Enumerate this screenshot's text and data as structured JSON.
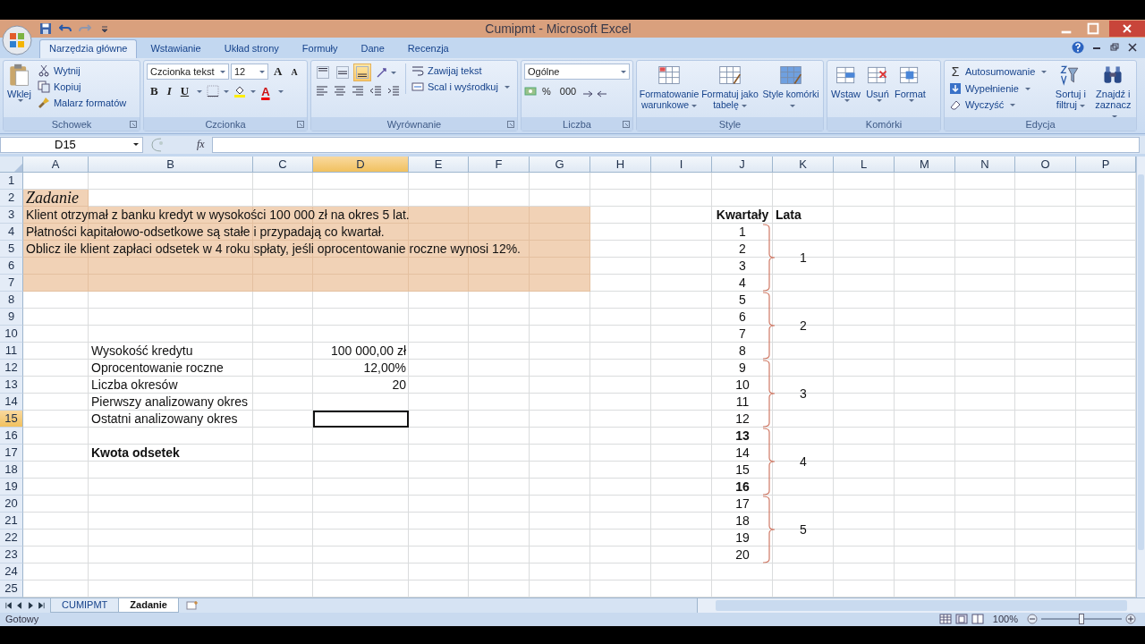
{
  "window": {
    "title": "Cumipmt - Microsoft Excel"
  },
  "tabs": [
    {
      "label": "Narzędzia główne",
      "selected": true
    },
    {
      "label": "Wstawianie",
      "selected": false
    },
    {
      "label": "Układ strony",
      "selected": false
    },
    {
      "label": "Formuły",
      "selected": false
    },
    {
      "label": "Dane",
      "selected": false
    },
    {
      "label": "Recenzja",
      "selected": false
    }
  ],
  "ribbon": {
    "clipboard": {
      "title": "Schowek",
      "paste": "Wklej",
      "cut": "Wytnij",
      "copy": "Kopiuj",
      "painter": "Malarz formatów"
    },
    "font": {
      "title": "Czcionka",
      "font_name": "Czcionka tekst",
      "font_size": "12",
      "grow": "A",
      "shrink": "A",
      "bold": "B",
      "italic": "I",
      "underline": "U",
      "text_color_letter": "A"
    },
    "alignment": {
      "title": "Wyrównanie",
      "vertical": [
        {
          "selected": false
        },
        {
          "selected": false
        },
        {
          "selected": true
        }
      ],
      "wrap": "Zawijaj tekst",
      "merge": "Scal i wyśrodkuj"
    },
    "number": {
      "title": "Liczba",
      "format": "Ogólne",
      "percent": "%",
      "thousands": "000"
    },
    "styles": {
      "title": "Style",
      "items": [
        "Formatowanie warunkowe",
        "Formatuj jako tabelę",
        "Style komórki"
      ]
    },
    "cells": {
      "title": "Komórki",
      "items": [
        "Wstaw",
        "Usuń",
        "Format"
      ]
    },
    "editing": {
      "title": "Edycja",
      "sigma": "Σ",
      "autosum": "Autosumowanie",
      "fill": "Wypełnienie",
      "clear": "Wyczyść",
      "sort": "Sortuj i filtruj",
      "find": "Znajdź i zaznacz"
    }
  },
  "formula_bar": {
    "name_box": "D15",
    "fx": "fx"
  },
  "sheet": {
    "columns": [
      {
        "label": "A",
        "selected": false
      },
      {
        "label": "B",
        "selected": false
      },
      {
        "label": "C",
        "selected": false
      },
      {
        "label": "D",
        "selected": true
      },
      {
        "label": "E",
        "selected": false
      },
      {
        "label": "F",
        "selected": false
      },
      {
        "label": "G",
        "selected": false
      },
      {
        "label": "H",
        "selected": false
      },
      {
        "label": "I",
        "selected": false
      },
      {
        "label": "J",
        "selected": false
      },
      {
        "label": "K",
        "selected": false
      },
      {
        "label": "L",
        "selected": false
      },
      {
        "label": "M",
        "selected": false
      },
      {
        "label": "N",
        "selected": false
      },
      {
        "label": "O",
        "selected": false
      },
      {
        "label": "P",
        "selected": false
      }
    ],
    "rows": [
      {
        "label": "1",
        "selected": false,
        "cells": {}
      },
      {
        "label": "2",
        "selected": false,
        "cells": {
          "A": {
            "text": "Zadanie",
            "italic": true,
            "shaded": true
          }
        }
      },
      {
        "label": "3",
        "selected": false,
        "cells": {
          "A": {
            "text": "Klient otrzymał z banku kredyt w wysokości 100 000 zł na okres 5 lat.",
            "shaded": true
          },
          "B": {
            "shaded": true
          },
          "C": {
            "shaded": true
          },
          "D": {
            "shaded": true
          },
          "E": {
            "shaded": true
          },
          "F": {
            "shaded": true
          },
          "G": {
            "shaded": true
          },
          "J": {
            "text": "Kwartały",
            "bold": true
          },
          "K": {
            "text": "Lata",
            "bold": true
          }
        }
      },
      {
        "label": "4",
        "selected": false,
        "cells": {
          "A": {
            "text": "Płatności kapitałowo-odsetkowe są stałe i przypadają co kwartał.",
            "shaded": true
          },
          "B": {
            "shaded": true
          },
          "C": {
            "shaded": true
          },
          "D": {
            "shaded": true
          },
          "E": {
            "shaded": true
          },
          "F": {
            "shaded": true
          },
          "G": {
            "shaded": true
          },
          "J": {
            "text": "1"
          }
        }
      },
      {
        "label": "5",
        "selected": false,
        "cells": {
          "A": {
            "text": "Oblicz ile klient zapłaci odsetek w 4 roku spłaty, jeśli oprocentowanie roczne wynosi 12%.",
            "shaded": true
          },
          "B": {
            "shaded": true
          },
          "C": {
            "shaded": true
          },
          "D": {
            "shaded": true
          },
          "E": {
            "shaded": true
          },
          "F": {
            "shaded": true
          },
          "G": {
            "shaded": true
          },
          "J": {
            "text": "2"
          }
        }
      },
      {
        "label": "6",
        "selected": false,
        "cells": {
          "A": {
            "shaded": true
          },
          "B": {
            "shaded": true
          },
          "C": {
            "shaded": true
          },
          "D": {
            "shaded": true
          },
          "E": {
            "shaded": true
          },
          "F": {
            "shaded": true
          },
          "G": {
            "shaded": true
          },
          "J": {
            "text": "3"
          }
        }
      },
      {
        "label": "7",
        "selected": false,
        "cells": {
          "A": {
            "shaded": true
          },
          "B": {
            "shaded": true
          },
          "C": {
            "shaded": true
          },
          "D": {
            "shaded": true
          },
          "E": {
            "shaded": true
          },
          "F": {
            "shaded": true
          },
          "G": {
            "shaded": true
          },
          "J": {
            "text": "4"
          }
        }
      },
      {
        "label": "8",
        "selected": false,
        "cells": {
          "J": {
            "text": "5"
          }
        }
      },
      {
        "label": "9",
        "selected": false,
        "cells": {
          "J": {
            "text": "6"
          }
        }
      },
      {
        "label": "10",
        "selected": false,
        "cells": {
          "J": {
            "text": "7"
          }
        }
      },
      {
        "label": "11",
        "selected": false,
        "cells": {
          "B": {
            "text": "Wysokość kredytu"
          },
          "D": {
            "text": "100 000,00 zł"
          },
          "J": {
            "text": "8"
          }
        }
      },
      {
        "label": "12",
        "selected": false,
        "cells": {
          "B": {
            "text": "Oprocentowanie roczne"
          },
          "D": {
            "text": "12,00%"
          },
          "J": {
            "text": "9"
          }
        }
      },
      {
        "label": "13",
        "selected": false,
        "cells": {
          "B": {
            "text": "Liczba okresów"
          },
          "D": {
            "text": "20"
          },
          "J": {
            "text": "10"
          }
        }
      },
      {
        "label": "14",
        "selected": false,
        "cells": {
          "B": {
            "text": "Pierwszy analizowany okres"
          },
          "J": {
            "text": "11"
          }
        }
      },
      {
        "label": "15",
        "selected": true,
        "cells": {
          "B": {
            "text": "Ostatni analizowany okres"
          },
          "D": {
            "selected": true
          },
          "J": {
            "text": "12"
          }
        }
      },
      {
        "label": "16",
        "selected": false,
        "cells": {
          "J": {
            "text": "13",
            "bold": true
          }
        }
      },
      {
        "label": "17",
        "selected": false,
        "cells": {
          "B": {
            "text": "Kwota odsetek",
            "bold": true
          },
          "J": {
            "text": "14"
          }
        }
      },
      {
        "label": "18",
        "selected": false,
        "cells": {
          "J": {
            "text": "15"
          }
        }
      },
      {
        "label": "19",
        "selected": false,
        "cells": {
          "J": {
            "text": "16",
            "bold": true
          }
        }
      },
      {
        "label": "20",
        "selected": false,
        "cells": {
          "J": {
            "text": "17"
          }
        }
      },
      {
        "label": "21",
        "selected": false,
        "cells": {
          "J": {
            "text": "18"
          }
        }
      },
      {
        "label": "22",
        "selected": false,
        "cells": {
          "J": {
            "text": "19"
          }
        }
      },
      {
        "label": "23",
        "selected": false,
        "cells": {
          "J": {
            "text": "20"
          }
        }
      },
      {
        "label": "24",
        "selected": false,
        "cells": {}
      },
      {
        "label": "25",
        "selected": false,
        "cells": {}
      }
    ],
    "braces": [
      {
        "label": "1"
      },
      {
        "label": "2"
      },
      {
        "label": "3"
      },
      {
        "label": "4"
      },
      {
        "label": "5"
      }
    ]
  },
  "sheet_tabs": [
    {
      "label": "CUMIPMT",
      "selected": false
    },
    {
      "label": "Zadanie",
      "selected": true
    }
  ],
  "status_bar": {
    "status": "Gotowy",
    "zoom": "100%",
    "zoom_slider": {
      "level": 0.5
    }
  }
}
